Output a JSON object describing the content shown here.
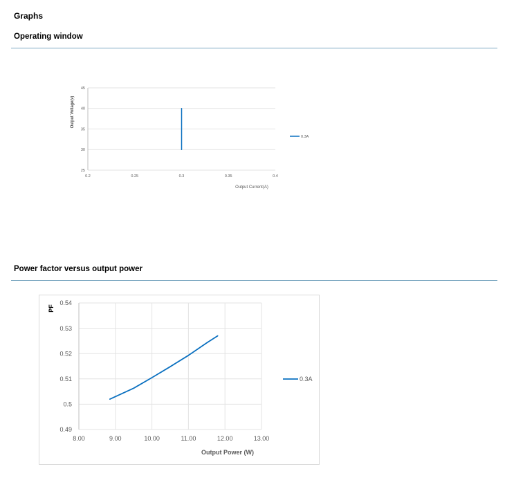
{
  "page": {
    "heading": "Graphs",
    "section1_title": "Operating window",
    "section2_title": "Power factor versus output power"
  },
  "colors": {
    "series": "#0a70c0",
    "grid": "#e3e3e3",
    "rule": "#7ba7c1",
    "axis_text": "#595959"
  },
  "chart_data": [
    {
      "type": "line",
      "title": "",
      "xlabel": "Output Current(A)",
      "ylabel": "Output Voltage(v)",
      "xlim": [
        0.2,
        0.4
      ],
      "ylim": [
        25,
        45
      ],
      "x_ticks": [
        "0.2",
        "0.25",
        "0.3",
        "0.35",
        "0.4"
      ],
      "y_ticks": [
        "25",
        "30",
        "35",
        "40",
        "45"
      ],
      "series": [
        {
          "name": "0.3A",
          "x": [
            0.3,
            0.3
          ],
          "y": [
            30,
            40
          ]
        }
      ],
      "grid": "horizontal",
      "legend": "right"
    },
    {
      "type": "line",
      "title": "",
      "xlabel": "Output Power (W)",
      "ylabel": "PF",
      "xlim": [
        8.0,
        13.0
      ],
      "ylim": [
        0.49,
        0.54
      ],
      "x_ticks": [
        "8.00",
        "9.00",
        "10.00",
        "11.00",
        "12.00",
        "13.00"
      ],
      "y_ticks": [
        "0.49",
        "0.5",
        "0.51",
        "0.52",
        "0.53",
        "0.54"
      ],
      "series": [
        {
          "name": "0.3A",
          "x": [
            8.85,
            9.5,
            10.0,
            10.5,
            11.0,
            11.5,
            11.8
          ],
          "y": [
            0.502,
            0.5063,
            0.5105,
            0.5148,
            0.5193,
            0.5242,
            0.527
          ]
        }
      ],
      "grid": "both",
      "legend": "right"
    }
  ]
}
